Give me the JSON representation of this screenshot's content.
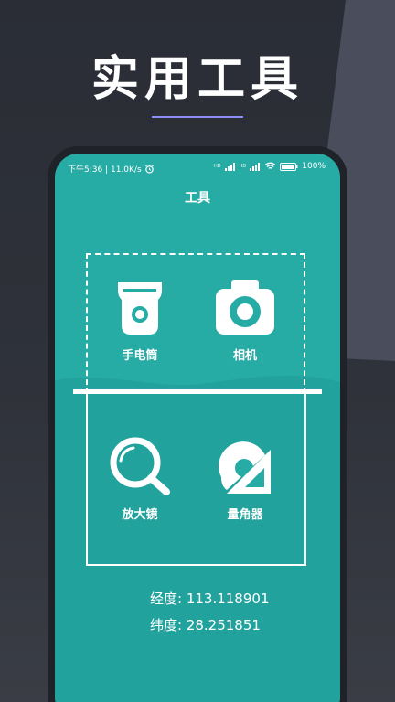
{
  "banner": {
    "title": "实用工具"
  },
  "status_bar": {
    "time_speed": "下午5:36 | 11.0K/s",
    "network_1": "HD",
    "network_2": "HD",
    "battery": "100%"
  },
  "header": {
    "title": "工具"
  },
  "tools": [
    {
      "label": "手电筒",
      "icon": "flashlight-icon"
    },
    {
      "label": "相机",
      "icon": "camera-icon"
    },
    {
      "label": "放大镜",
      "icon": "magnifier-icon"
    },
    {
      "label": "量角器",
      "icon": "protractor-icon"
    }
  ],
  "location": {
    "longitude": "经度: 113.118901",
    "latitude": "纬度: 28.251851"
  },
  "colors": {
    "screen_bg": "#27aba5",
    "wave_bg": "#22a29c",
    "background": "#2a2d35",
    "accent_line": "#8a8ff0"
  }
}
